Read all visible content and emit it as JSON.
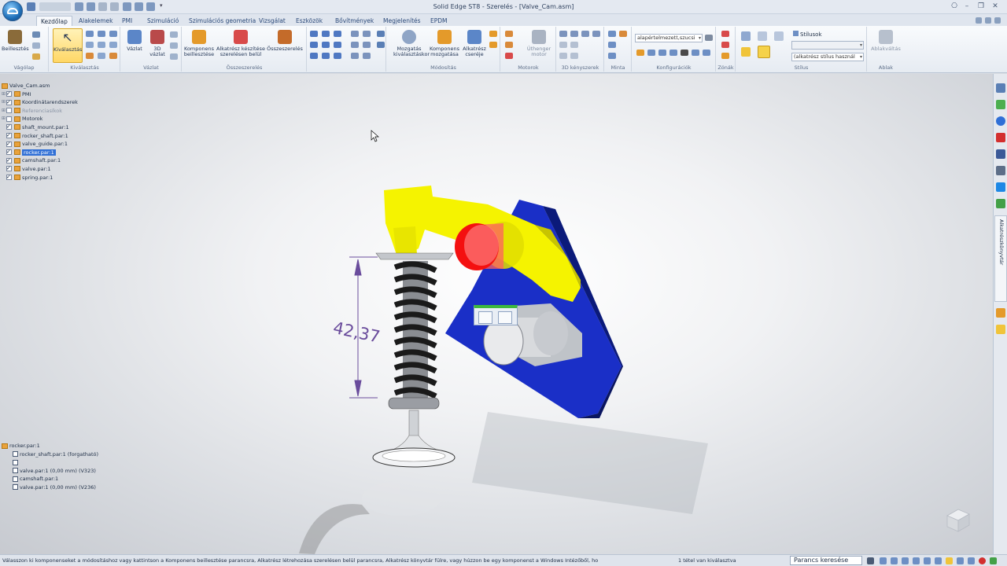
{
  "window": {
    "title": "Solid Edge ST8 - Szerelés - [Valve_Cam.asm]"
  },
  "tabs": [
    "Kezdőlap",
    "Alakelemek",
    "PMI",
    "Szimuláció",
    "Szimulációs geometria",
    "Vizsgálat",
    "Eszközök",
    "Bővítmények",
    "Megjelenítés",
    "EPDM"
  ],
  "ribbon": {
    "vagolap": {
      "label": "Vágólap",
      "paste": "Beillesztés"
    },
    "kivalasztas": {
      "label": "Kiválasztás",
      "select": "Kiválasztás"
    },
    "vazlat": {
      "label": "Vázlat",
      "sketch": "Vázlat",
      "sketch3d_line1": "3D",
      "sketch3d_line2": "vázlat"
    },
    "osszeszereles": {
      "label": "Összeszerelés",
      "insert_line1": "Komponens",
      "insert_line2": "beillesztése",
      "create_line1": "Alkatrész készítése",
      "create_line2": "szerelésen belül",
      "assemble": "Összeszerelés"
    },
    "mozgatas": {
      "label": "Módosítás",
      "move_line1": "Mozgatás",
      "move_line2": "kiválasztáskor",
      "movecomp_line1": "Komponens",
      "movecomp_line2": "mozgatása",
      "replace_line1": "Alkatrész",
      "replace_line2": "cseréje"
    },
    "motorok": {
      "label": "Motorok",
      "btn_line1": "Úthenger",
      "btn_line2": "motor"
    },
    "ker3d": {
      "label": "3D kényszerek"
    },
    "minta": {
      "label": "Minta"
    },
    "konfig": {
      "label": "Konfigurációk",
      "combo": "alapértelmezett,szucsi"
    },
    "zonak": {
      "label": "Zónák"
    },
    "stilus": {
      "label": "Stílus",
      "stilusok": "Stílusok",
      "combo": "(alkatrész stílus használ"
    },
    "ablak": {
      "label": "Ablak",
      "btn": "Ablakváltás"
    }
  },
  "tree": {
    "root": "Valve_Cam.asm",
    "items": [
      {
        "label": "PMI",
        "checked": true,
        "expand": true
      },
      {
        "label": "Koordinátarendszerek",
        "checked": true,
        "expand": true
      },
      {
        "label": "Referenciasíkok",
        "checked": false,
        "expand": true,
        "dim": true
      },
      {
        "label": "Motorok",
        "checked": false,
        "expand": true
      },
      {
        "label": "shaft_mount.par:1",
        "checked": true
      },
      {
        "label": "rocker_shaft.par:1",
        "checked": true
      },
      {
        "label": "valve_guide.par:1",
        "checked": true
      },
      {
        "label": "rocker.par:1",
        "checked": true,
        "selected": true
      },
      {
        "label": "camshaft.par:1",
        "checked": true
      },
      {
        "label": "valve.par:1",
        "checked": true
      },
      {
        "label": "spring.par:1",
        "checked": true
      }
    ]
  },
  "relations": {
    "header": "rocker.par:1",
    "items": [
      "rocker_shaft.par:1   (forgatható)",
      "",
      "valve.par:1   (0,00 mm)   (V323)",
      "camshaft.par:1",
      "valve.par:1   (0,00 mm)   (V236)"
    ]
  },
  "dimension": {
    "value": "42,37"
  },
  "dock": {
    "library_tab": "Alkatrészkönyvtár"
  },
  "status": {
    "message": "Válasszon ki komponenseket a módosításhoz vagy kattintson a Komponens beillesztése parancsra, Alkatrész létrehozása szerelésen belül parancsra, Alkatrész könyvtár fülre, vagy húzzon be egy komponenst a Windows Intézőből, ho",
    "selection": "1 tétel van kiválasztva",
    "search_placeholder": "Parancs keresése"
  },
  "colors": {
    "rocker": "#f4f300",
    "plate": "#1030c8",
    "highlight": "#ff1010",
    "dimension": "#6a4c9c"
  }
}
